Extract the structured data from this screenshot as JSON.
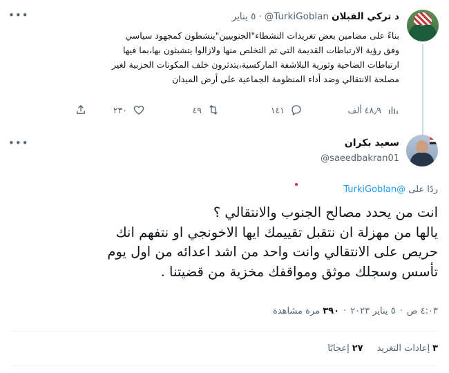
{
  "parent": {
    "name": "د تركي الفبلان",
    "handle": "@TurkiGoblan",
    "dot": "·",
    "date": "٥ يناير",
    "more_icon": "more-horizontal-icon",
    "text_lines": [
      "بناءً على مضامين بعض تغريدات النشطاء\"الجنوبيين\"ينشطون كمجهود سياسي",
      "وفق رؤية الارتباطات القديمة التي تم التخلص منها ولازالوا يتشبثون بها،بما فيها",
      "ارتباطات الضاحية وثورية البلاشفة الماركسية،يتدثرون خلف المكونات الحزبية لغير",
      "مصلحة الانتقالي وضد أداء المنظومة الجماعية على أرض الميدان"
    ],
    "actions": {
      "views": "٤٨٫٩ ألف",
      "replies": "١٤١",
      "retweets": "٤٩",
      "likes": "٢٣٠"
    }
  },
  "focus": {
    "name": "سعيد بكران",
    "handle": "@saeedbakran01",
    "reply_prefix": "ردًا على",
    "reply_mention": "@TurkiGoblan",
    "text_lines": [
      "انت من يحدد مصالح الجنوب والانتقالي ؟",
      "يالها من مهزلة ان نتقبل تقييمك ايها الاخونجي او نتفهم انك",
      "حريص على الانتقالي وانت واحد من اشد اعدائه من اول يوم",
      "تأسس وسجلك موثق ومواقفك مخزية من قضيتنا ."
    ],
    "time": "٤:٠٣ ص",
    "date": "٥ يناير ٢٠٢٣",
    "dot": "·",
    "views_count": "٣٩٠",
    "views_label": "مرة مشاهدة",
    "retweets_count": "٣",
    "retweets_label": "إعادات التغريد",
    "likes_count": "٢٧",
    "likes_label": "إعجابًا"
  },
  "colors": {
    "accent": "#1d9bf0",
    "text": "#0f1419",
    "muted": "#536471",
    "divider": "#eff3f4"
  }
}
